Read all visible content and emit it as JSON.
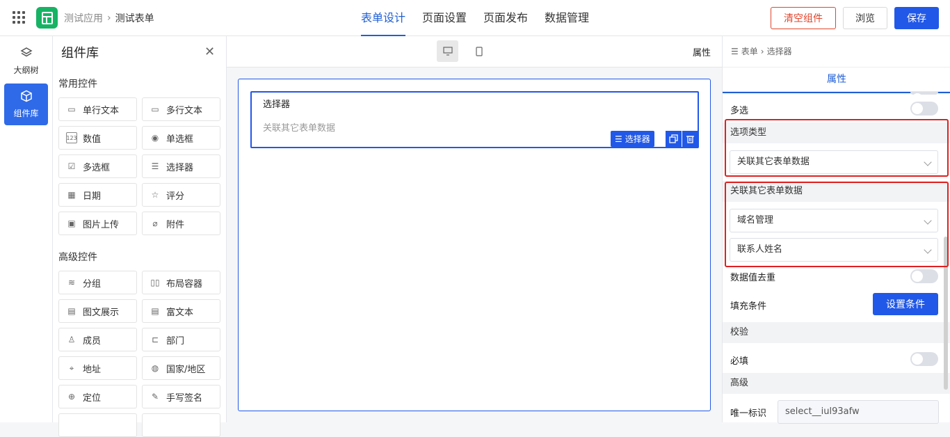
{
  "header": {
    "app_name": "测试应用",
    "form_name": "测试表单",
    "tabs": [
      "表单设计",
      "页面设置",
      "页面发布",
      "数据管理"
    ],
    "clear_label": "清空组件",
    "preview_label": "浏览",
    "save_label": "保存"
  },
  "leftnav": {
    "outline_label": "大纲树",
    "library_label": "组件库"
  },
  "library": {
    "title": "组件库",
    "common_title": "常用控件",
    "advanced_title": "高级控件",
    "common": [
      "单行文本",
      "多行文本",
      "数值",
      "单选框",
      "多选框",
      "选择器",
      "日期",
      "评分",
      "图片上传",
      "附件"
    ],
    "advanced": [
      "分组",
      "布局容器",
      "图文展示",
      "富文本",
      "成员",
      "部门",
      "地址",
      "国家/地区",
      "定位",
      "手写签名"
    ]
  },
  "canvas": {
    "props_label": "属性",
    "field_label": "选择器",
    "field_placeholder": "关联其它表单数据",
    "field_tag": "选择器"
  },
  "props": {
    "crumb_root": "表单",
    "crumb_current": "选择器",
    "tab": "属性",
    "multi_label": "多选",
    "option_type_title": "选项类型",
    "option_type_value": "关联其它表单数据",
    "linked_title": "关联其它表单数据",
    "linked_form": "域名管理",
    "linked_field": "联系人姓名",
    "dedupe_label": "数据值去重",
    "fill_label": "填充条件",
    "fill_button": "设置条件",
    "validate_title": "校验",
    "required_label": "必填",
    "advanced_title": "高级",
    "unique_label": "唯一标识",
    "unique_value": "select__iul93afw"
  }
}
